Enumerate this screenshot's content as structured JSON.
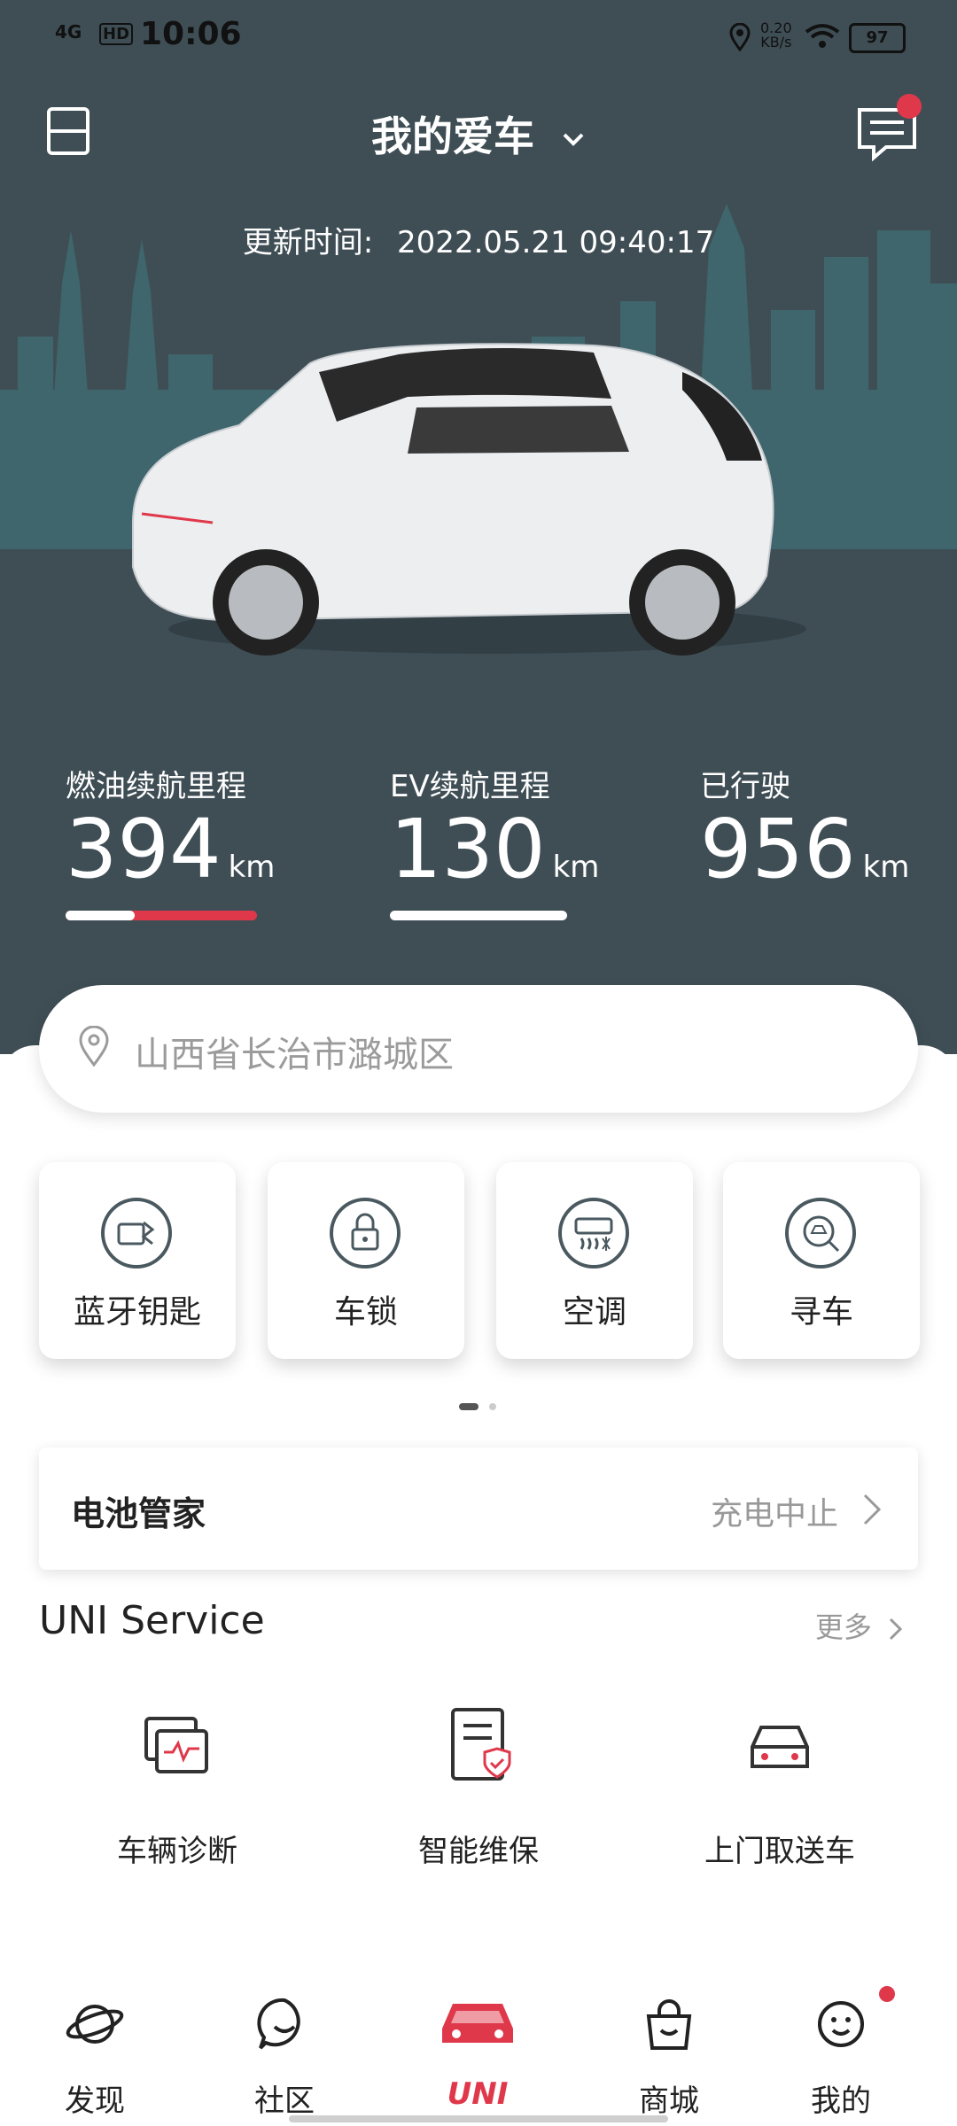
{
  "status_bar": {
    "time": "10:06",
    "network": "4G",
    "hd": "HD",
    "speed_value": "0.20",
    "speed_unit": "KB/s",
    "battery": "97"
  },
  "header": {
    "title": "我的爱车"
  },
  "update": {
    "label": "更新时间:",
    "value": "2022.05.21 09:40:17"
  },
  "stats": [
    {
      "label": "燃油续航里程",
      "value": "394",
      "unit": "km"
    },
    {
      "label": "EV续航里程",
      "value": "130",
      "unit": "km"
    },
    {
      "label": "已行驶",
      "value": "956",
      "unit": "km"
    }
  ],
  "address": {
    "text": "山西省长治市潞城区"
  },
  "quick_actions": [
    {
      "label": "蓝牙钥匙",
      "icon": "bluetooth-key-icon"
    },
    {
      "label": "车锁",
      "icon": "lock-icon"
    },
    {
      "label": "空调",
      "icon": "air-conditioner-icon"
    },
    {
      "label": "寻车",
      "icon": "find-car-icon"
    }
  ],
  "battery_card": {
    "title": "电池管家",
    "status": "充电中止"
  },
  "service": {
    "title": "UNI Service",
    "more": "更多",
    "items": [
      {
        "label": "车辆诊断",
        "icon": "vehicle-diagnosis-icon"
      },
      {
        "label": "智能维保",
        "icon": "smart-maintenance-icon"
      },
      {
        "label": "上门取送车",
        "icon": "car-pickup-icon"
      }
    ]
  },
  "tabs": [
    {
      "label": "发现",
      "icon": "planet-icon"
    },
    {
      "label": "社区",
      "icon": "chat-bubble-icon"
    },
    {
      "label": "UNI",
      "icon": "uni-car-icon"
    },
    {
      "label": "商城",
      "icon": "shopping-bag-icon"
    },
    {
      "label": "我的",
      "icon": "profile-icon"
    }
  ],
  "colors": {
    "header_bg": "#3f4e55",
    "accent_red": "#e0384b",
    "white": "#ffffff"
  }
}
